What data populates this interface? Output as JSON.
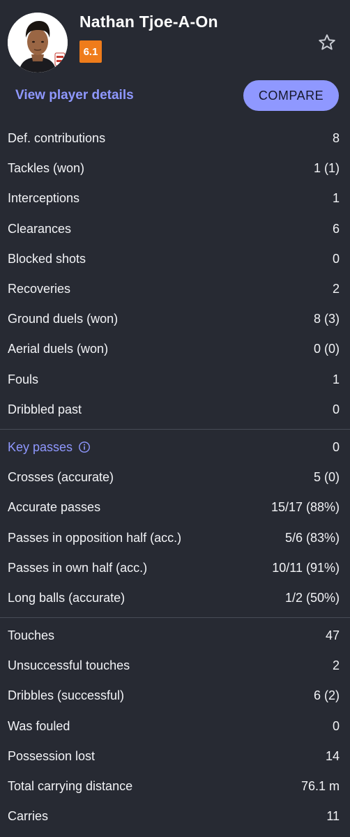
{
  "header": {
    "player_name": "Nathan Tjoe-A-On",
    "rating": "6.1",
    "details_link": "View player details",
    "compare_button": "COMPARE",
    "rating_color": "#ef7c1b",
    "accent_color": "#8f98ff",
    "favorite_icon": "star-outline-icon"
  },
  "defense": [
    {
      "label": "Def. contributions",
      "value": "8"
    },
    {
      "label": "Tackles (won)",
      "value": "1 (1)"
    },
    {
      "label": "Interceptions",
      "value": "1"
    },
    {
      "label": "Clearances",
      "value": "6"
    },
    {
      "label": "Blocked shots",
      "value": "0"
    },
    {
      "label": "Recoveries",
      "value": "2"
    },
    {
      "label": "Ground duels (won)",
      "value": "8 (3)"
    },
    {
      "label": "Aerial duels (won)",
      "value": "0 (0)"
    },
    {
      "label": "Fouls",
      "value": "1"
    },
    {
      "label": "Dribbled past",
      "value": "0"
    }
  ],
  "passing": [
    {
      "label": "Key passes",
      "value": "0"
    },
    {
      "label": "Crosses (accurate)",
      "value": "5 (0)"
    },
    {
      "label": "Accurate passes",
      "value": "15/17 (88%)"
    },
    {
      "label": "Passes in opposition half (acc.)",
      "value": "5/6 (83%)"
    },
    {
      "label": "Passes in own half (acc.)",
      "value": "10/11 (91%)"
    },
    {
      "label": "Long balls (accurate)",
      "value": "1/2 (50%)"
    }
  ],
  "possession": [
    {
      "label": "Touches",
      "value": "47"
    },
    {
      "label": "Unsuccessful touches",
      "value": "2"
    },
    {
      "label": "Dribbles (successful)",
      "value": "6 (2)"
    },
    {
      "label": "Was fouled",
      "value": "0"
    },
    {
      "label": "Possession lost",
      "value": "14"
    },
    {
      "label": "Total carrying distance",
      "value": "76.1 m"
    },
    {
      "label": "Carries",
      "value": "11"
    }
  ]
}
